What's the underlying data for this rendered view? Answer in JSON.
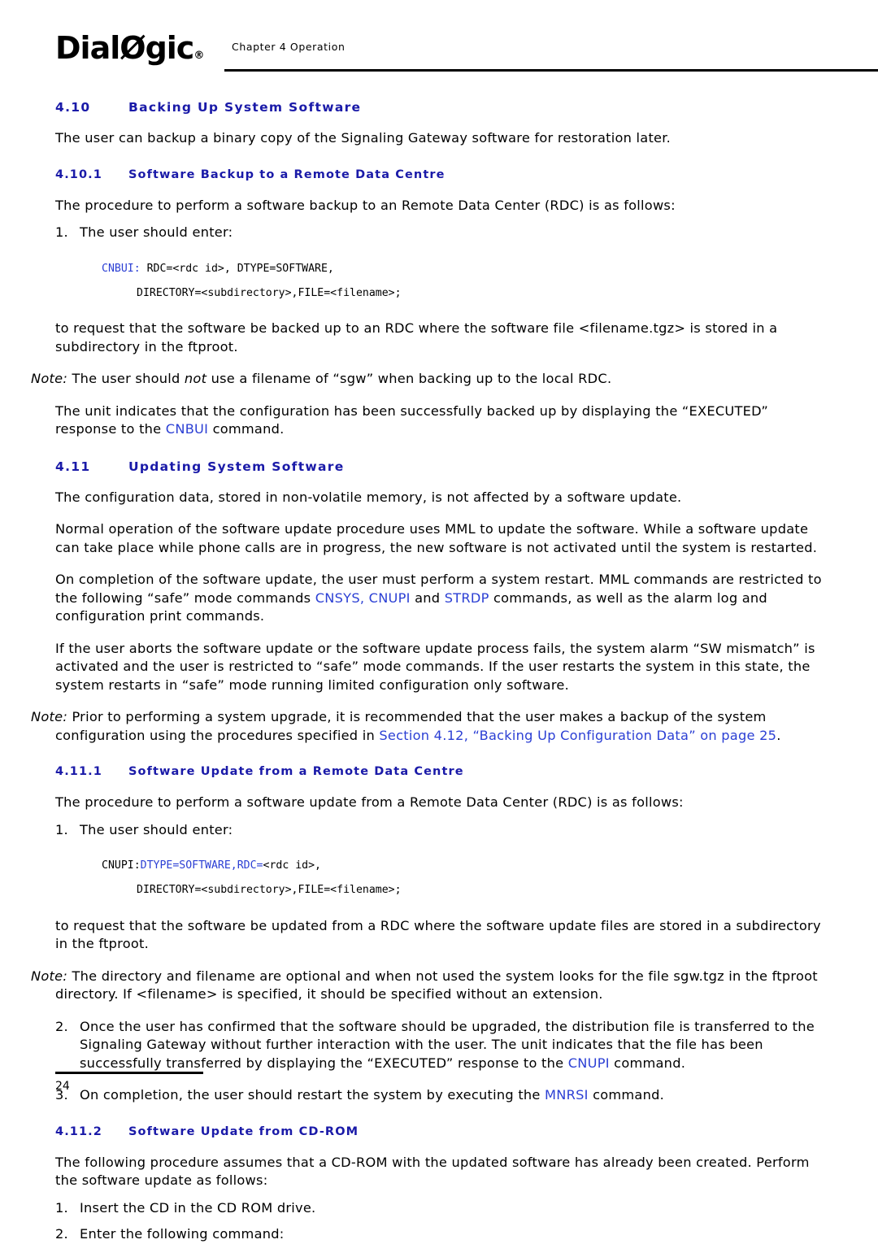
{
  "header": {
    "logo_text": "Dial",
    "logo_text2": "gic",
    "logo_reg": "®",
    "chapter": "Chapter 4 Operation"
  },
  "sections": {
    "s410": {
      "num": "4.10",
      "title": "Backing Up System Software",
      "para1": "The user can backup a binary copy of the Signaling Gateway software for restoration later."
    },
    "s4101": {
      "num": "4.10.1",
      "title": "Software Backup to a Remote Data Centre",
      "para1": "The procedure to perform a software backup to an Remote Data Center (RDC) is as follows:",
      "step1_marker": "1.",
      "step1": "The user should enter:",
      "code_line1_a": "CNBUI: ",
      "code_line1_b": "RDC=<rdc id>, DTYPE=SOFTWARE,",
      "code_line2": "DIRECTORY=<subdirectory>,FILE=<filename>;",
      "para2": "to request that the software be backed up to an RDC where the software file <filename.tgz> is stored in a subdirectory in the ftproot.",
      "note_label": "Note:",
      "note_text_a": "The user should ",
      "note_text_b": "not",
      "note_text_c": " use a filename of “sgw” when backing up to the local RDC.",
      "para3_a": "The unit indicates that the configuration has been successfully backed up by displaying the “EXECUTED” response to the ",
      "para3_link": "CNBUI",
      "para3_b": " command."
    },
    "s411": {
      "num": "4.11",
      "title": "Updating System Software",
      "para1": "The configuration data, stored in non-volatile memory, is not affected by a software update.",
      "para2": "Normal operation of the software update procedure uses MML to update the software. While a software update can take place while phone calls are in progress, the new software is not activated until the system is restarted.",
      "para3_a": "On completion of the software update, the user must perform a system restart. MML commands are restricted to the following “safe” mode commands ",
      "para3_link1": "CNSYS, CNUPI",
      "para3_b": " and ",
      "para3_link2": "STRDP",
      "para3_c": " commands, as well as the alarm log and configuration print commands.",
      "para4": "If the user aborts the software update or the software update process fails, the system alarm “SW mismatch” is activated and the user is restricted to “safe” mode commands. If the user restarts the system in this state, the system restarts in “safe” mode running limited configuration only software.",
      "note_label": "Note:",
      "note_text_a": "Prior to performing a system upgrade, it is recommended that the user makes a backup of the system configuration using the procedures specified in ",
      "note_link": "Section 4.12, “Backing Up Configuration Data” on page 25",
      "note_text_b": "."
    },
    "s4111": {
      "num": "4.11.1",
      "title": "Software Update from a Remote Data Centre",
      "para1": "The procedure to perform a software update from a Remote Data Center (RDC) is as follows:",
      "step1_marker": "1.",
      "step1": "The user should enter:",
      "code_line1_a": "CNUPI:",
      "code_line1_b": "DTYPE=SOFTWARE,",
      "code_line1_c": "RDC=",
      "code_line1_d": "<rdc id>,",
      "code_line2": "DIRECTORY=<subdirectory>,FILE=<filename>;",
      "para2": "to request that the software be updated from a RDC where the software update files are stored in a subdirectory in the ftproot.",
      "note_label": "Note:",
      "note_text": "The directory and filename are optional and when not used the system looks for the file sgw.tgz in the ftproot directory. If <filename> is specified, it should be specified without an extension.",
      "step2_marker": "2.",
      "step2_a": "Once the user has confirmed that the software should be upgraded, the distribution file is transferred to the Signaling Gateway without further interaction with the user. The unit indicates that the file has been successfully transferred by displaying the “EXECUTED” response to the ",
      "step2_link": "CNUPI",
      "step2_b": " command.",
      "step3_marker": "3.",
      "step3_a": "On completion, the user should restart the system by executing the ",
      "step3_link": "MNRSI",
      "step3_b": " command."
    },
    "s4112": {
      "num": "4.11.2",
      "title": "Software Update from CD-ROM",
      "para1": "The following procedure assumes that a CD-ROM with the updated software has already been created. Perform the software update as follows:",
      "step1_marker": "1.",
      "step1": "Insert the CD in the CD ROM drive.",
      "step2_marker": "2.",
      "step2": "Enter the following command:"
    }
  },
  "footer": {
    "page_number": "24"
  },
  "colors": {
    "heading_blue": "#1a1aa8",
    "link_blue": "#2b3fd4"
  }
}
